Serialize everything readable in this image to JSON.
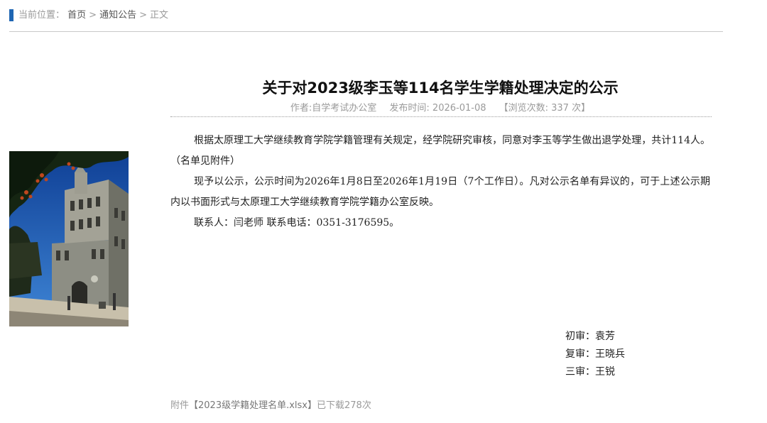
{
  "breadcrumb": {
    "label": "当前位置：",
    "items": [
      "首页",
      "通知公告"
    ],
    "current": "正文",
    "separator": ">"
  },
  "article": {
    "title": "关于对2023级李玉等114名学生学籍处理决定的公示",
    "author": "作者:自学考试办公室",
    "published": "发布时间: 2026-01-08",
    "views": "【浏览次数: 337 次】",
    "paragraphs": [
      "根据太原理工大学继续教育学院学籍管理有关规定，经学院研究审核，同意对李玉等学生做出退学处理，共计114人。（名单见附件）",
      "现予以公示，公示时间为2026年1月8日至2026年1月19日（7个工作日）。凡对公示名单有异议的，可于上述公示期内以书面形式与太原理工大学继续教育学院学籍办公室反映。",
      "联系人：闫老师 联系电话：0351-3176595。"
    ],
    "reviewers": [
      "初审：袁芳",
      "复审：王晓兵",
      "三审：王锐"
    ]
  },
  "attachment": {
    "prefix": "附件",
    "file": "【2023级学籍处理名单.xlsx】",
    "downloads": "已下载278次"
  },
  "colors": {
    "accent": "#1f66b3",
    "muted": "#9a9a9a",
    "sky": "#1d4f9d"
  }
}
